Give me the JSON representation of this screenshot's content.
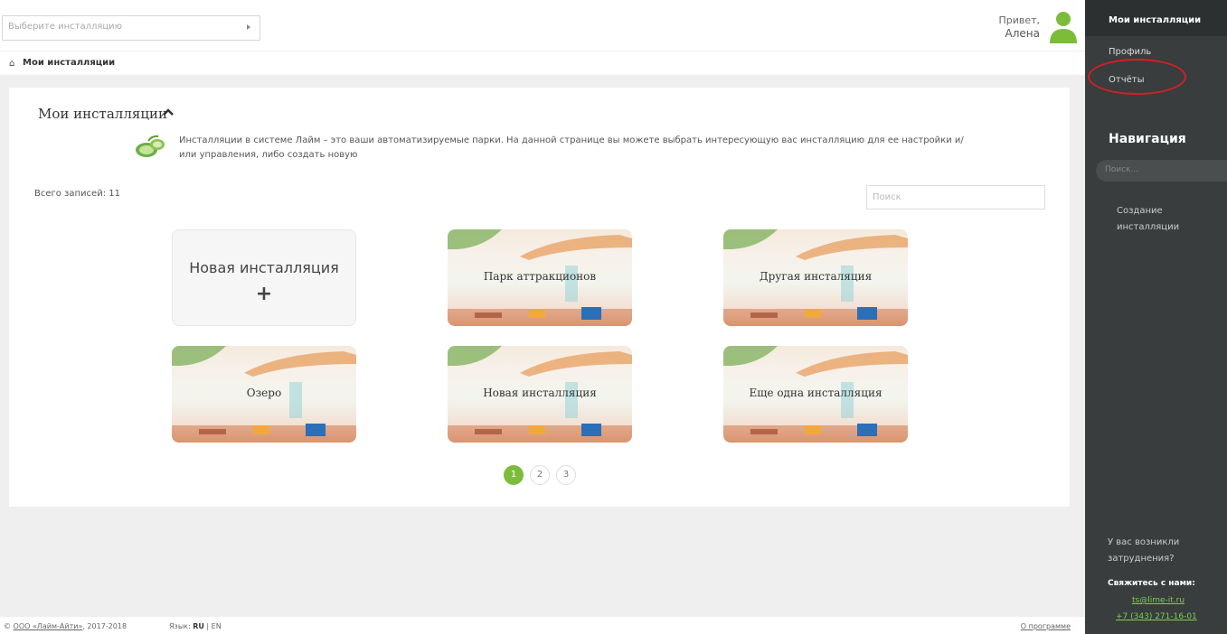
{
  "topbar": {
    "install_select_placeholder": "Выберите инсталляцию",
    "greeting_line1": "Привет,",
    "greeting_name": "Алена"
  },
  "breadcrumb": {
    "label": "Мои инсталляции"
  },
  "panel": {
    "title": "Мои инсталляции",
    "info_text": "Инсталляции в системе Лайм – это ваши автоматизируемые парки. На данной странице вы можете выбрать интересующую вас инсталляцию для ее настройки и/или управления, либо создать новую",
    "total_records": "Всего записей: 11",
    "search_placeholder": "Поиск"
  },
  "cards": {
    "new": {
      "label": "Новая инсталляция",
      "plus": "+"
    },
    "items": [
      {
        "label": "Парк аттракционов"
      },
      {
        "label": "Другая инсталяция"
      },
      {
        "label": "Озеро"
      },
      {
        "label": "Новая инсталляция"
      },
      {
        "label": "Еще одна инсталляция"
      }
    ]
  },
  "pagination": {
    "pages": [
      "1",
      "2",
      "3"
    ],
    "active": "1"
  },
  "footer": {
    "copyright_prefix": "© ",
    "company_link": "ООО «Лайм-Айти»",
    "years": ", 2017-2018",
    "lang_label": "Язык:",
    "lang_ru": "RU",
    "lang_sep": "|",
    "lang_en": "EN",
    "about": "О программе"
  },
  "sidebar": {
    "active_item": "Мои инсталляции",
    "items": [
      "Профиль",
      "Отчёты"
    ],
    "nav_title": "Навигация",
    "nav_search_placeholder": "Поиск...",
    "create_line1": "Создание",
    "create_line2": "инсталляции",
    "help_line1": "У вас возникли",
    "help_line2": "затруднения?",
    "contact_title": "Свяжитесь с нами:",
    "email": "ts@lime-it.ru",
    "phone": "+7 (343) 271-16-01"
  },
  "colors": {
    "accent_green": "#7bbd3b",
    "sidebar_bg": "#393d3e",
    "highlight_red": "#d21f27"
  }
}
